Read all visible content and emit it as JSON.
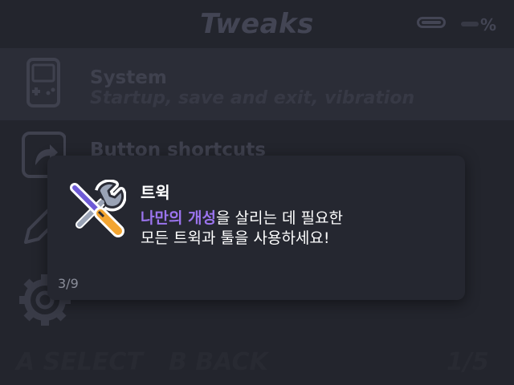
{
  "header": {
    "title": "Tweaks",
    "battery_percent_sign": "%"
  },
  "menu": {
    "items": [
      {
        "title": "System",
        "description": "Startup, save and exit, vibration",
        "icon": "gameboy-icon"
      },
      {
        "title": "Button shortcuts",
        "description": "",
        "icon": "shortcut-arrow-icon"
      },
      {
        "title": "",
        "description": "",
        "icon": "pencil-icon"
      },
      {
        "title": "",
        "description": "",
        "icon": "gear-icon"
      }
    ]
  },
  "footer": {
    "select_label": "A SELECT",
    "back_label": "B BACK",
    "page": "1/5"
  },
  "dialog": {
    "title": "트윅",
    "body_highlight": "나만의 개성",
    "body_line1_rest": "을 살리는 데 필요한",
    "body_line2": "모든 트윅과 툴을 사용하세요!",
    "page": "3/9",
    "icon": "wrench-screwdriver-icon",
    "accent_color": "#9b74ee"
  }
}
